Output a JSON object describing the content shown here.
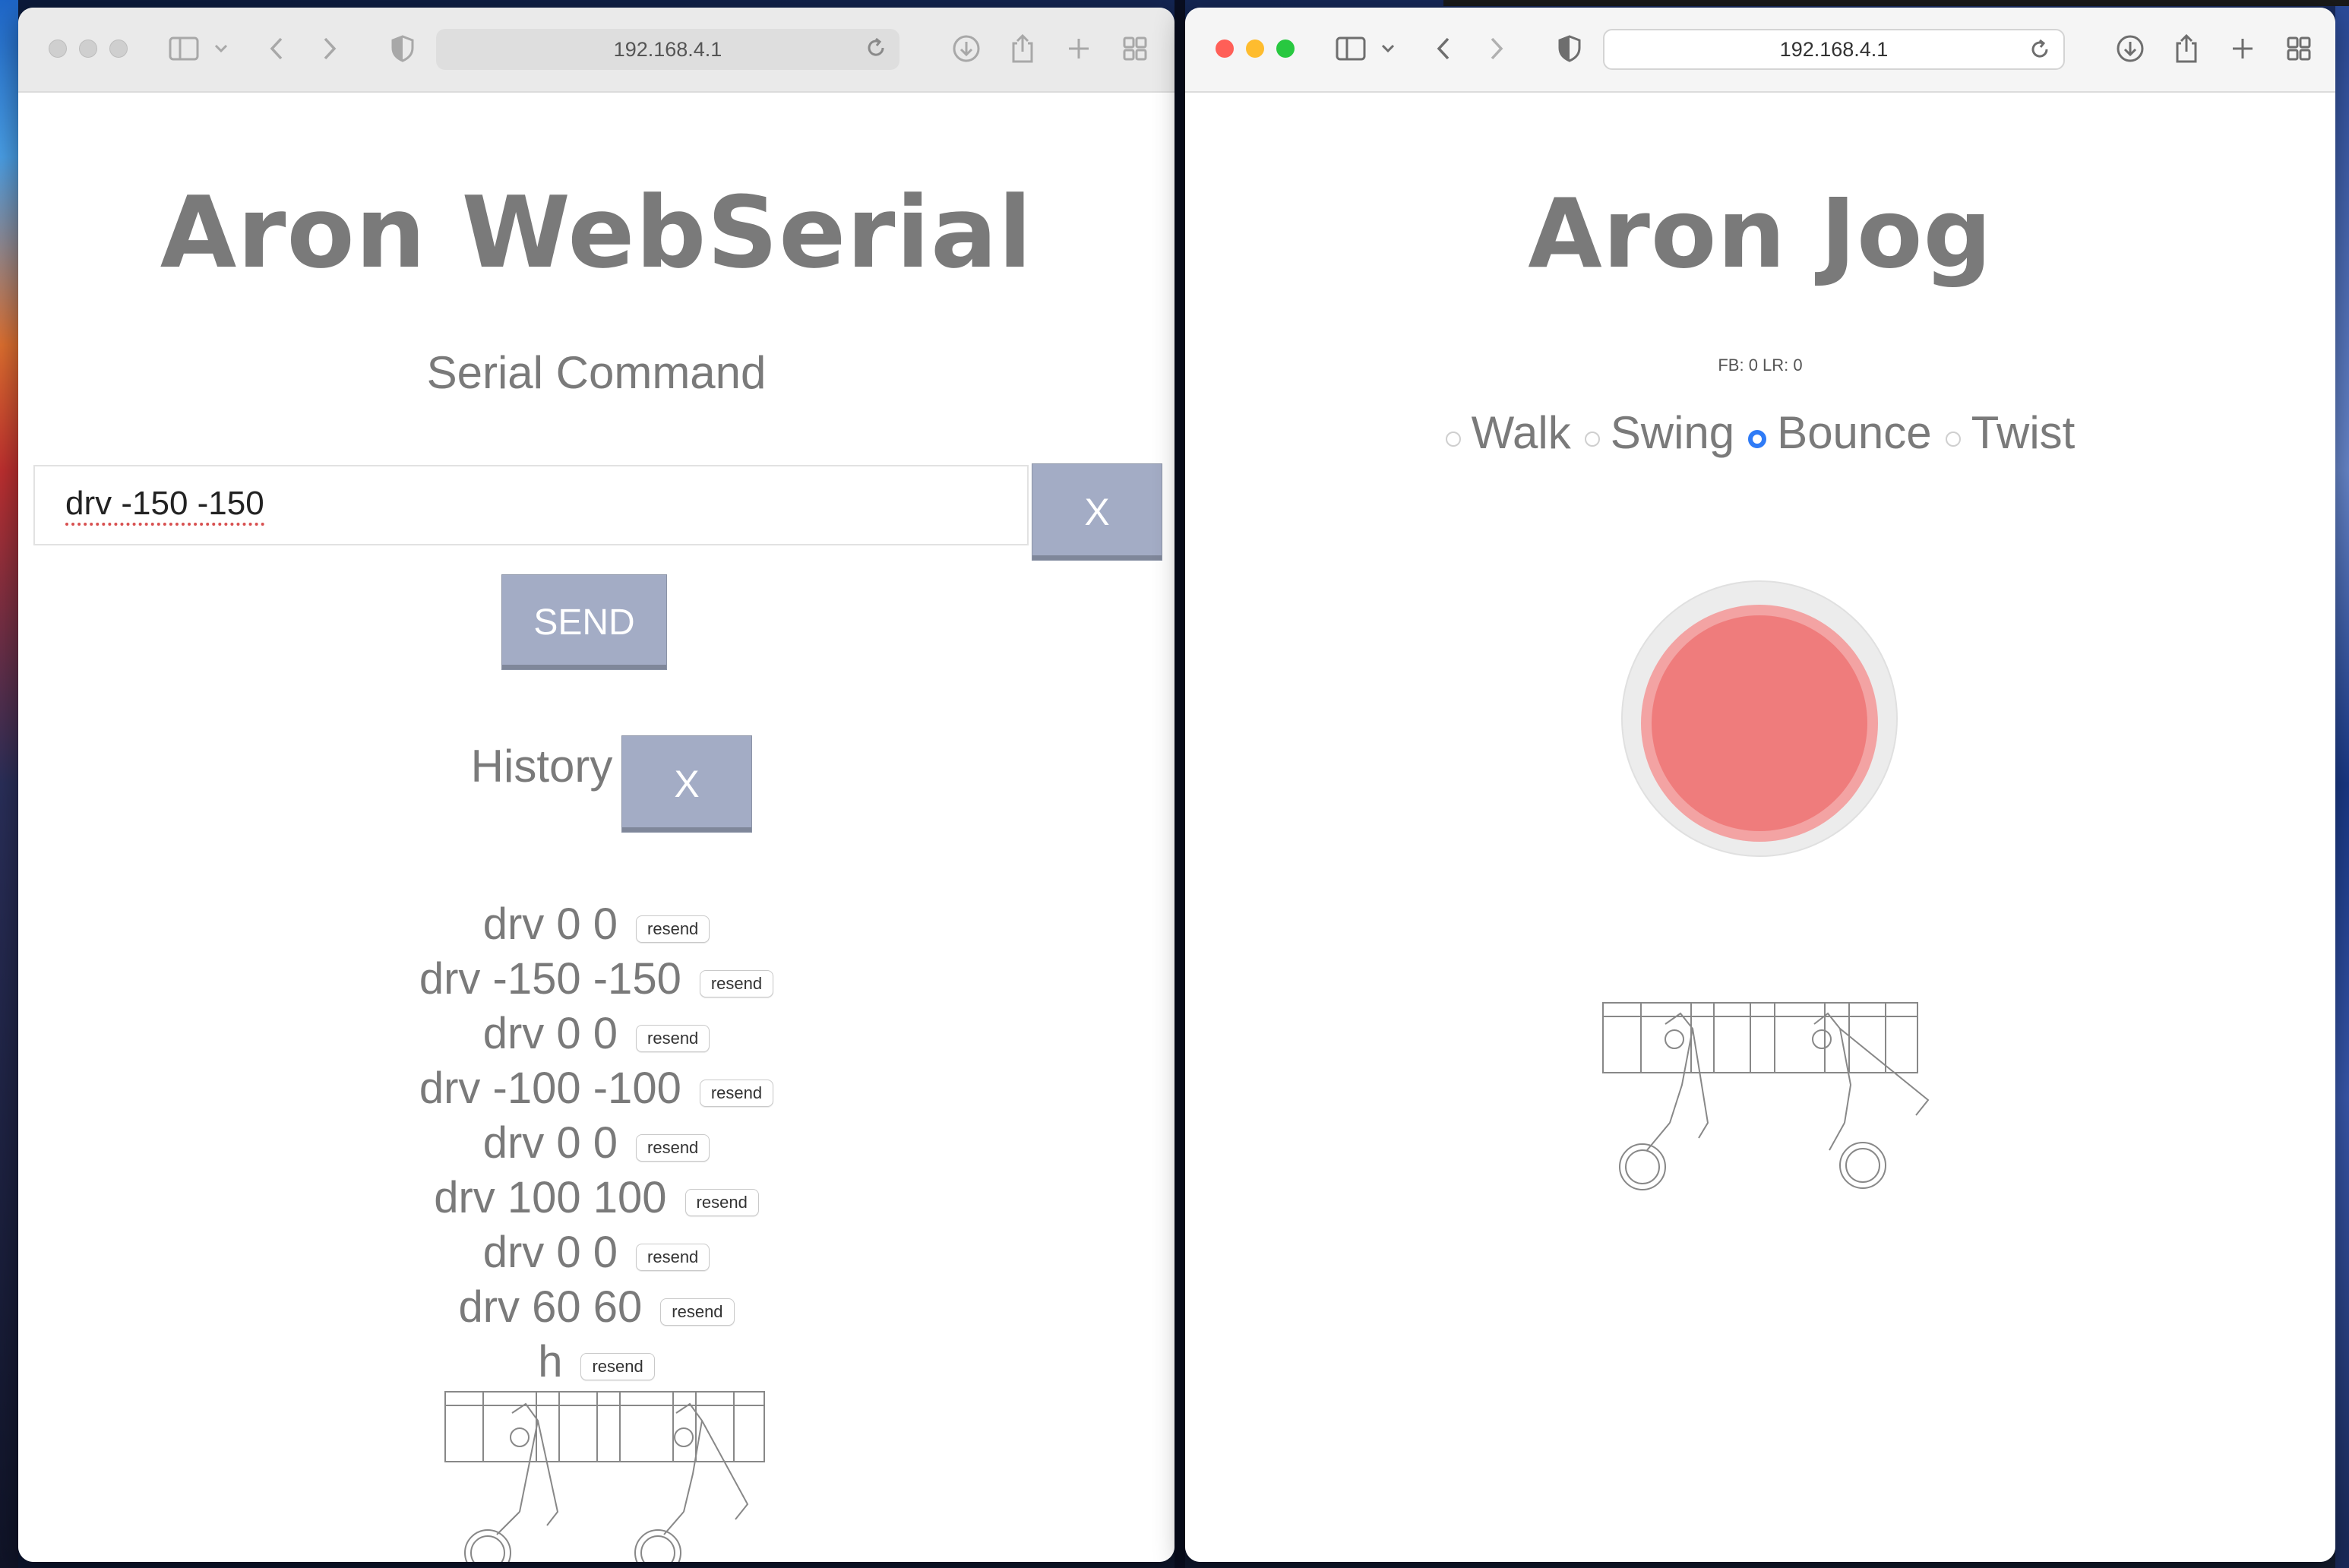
{
  "left_window": {
    "url": "192.168.4.1",
    "title": "Aron WebSerial",
    "section_title": "Serial Command",
    "command_value": "drv -150 -150",
    "clear_input_label": "X",
    "send_label": "SEND",
    "history_label": "History",
    "clear_history_label": "X",
    "history": [
      {
        "cmd": "drv 0 0",
        "action": "resend"
      },
      {
        "cmd": "drv -150 -150",
        "action": "resend"
      },
      {
        "cmd": "drv 0 0",
        "action": "resend"
      },
      {
        "cmd": "drv -100 -100",
        "action": "resend"
      },
      {
        "cmd": "drv 0 0",
        "action": "resend"
      },
      {
        "cmd": "drv 100 100",
        "action": "resend"
      },
      {
        "cmd": "drv 0 0",
        "action": "resend"
      },
      {
        "cmd": "drv 60 60",
        "action": "resend"
      },
      {
        "cmd": "h",
        "action": "resend"
      }
    ]
  },
  "right_window": {
    "url": "192.168.4.1",
    "title": "Aron Jog",
    "status": "FB: 0 LR: 0",
    "modes": [
      {
        "label": "Walk",
        "selected": false
      },
      {
        "label": "Swing",
        "selected": false
      },
      {
        "label": "Bounce",
        "selected": true
      },
      {
        "label": "Twist",
        "selected": false
      }
    ],
    "joystick_color": "#ef7c7c"
  }
}
